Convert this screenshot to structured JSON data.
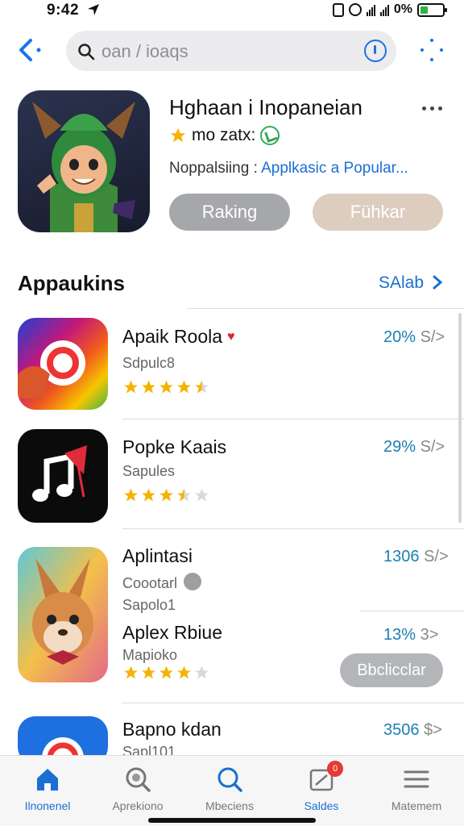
{
  "status_bar": {
    "time": "9:42",
    "battery": "0%"
  },
  "search": {
    "placeholder": "oan / ioaqs"
  },
  "featured": {
    "title": "Hghaan i Inopaneian",
    "meta": "mo zatx:",
    "subtitle_prefix": "Noppalsiing :",
    "subtitle_link": "Applkasic a Popular...",
    "buttons": {
      "primary": "Raking",
      "secondary": "Fühkar"
    }
  },
  "section": {
    "title": "Appaukins",
    "see_all": "SAlab"
  },
  "apps": [
    {
      "name": "Apaik Roola",
      "sub": "Sdpulc8",
      "pct": "20%",
      "pct_tail": "S/>",
      "rating": 4.5
    },
    {
      "name": "Popke Kaais",
      "sub": "Sapules",
      "pct": "29%",
      "pct_tail": "S/>",
      "rating": 3.5
    },
    {
      "name": "Aplintasi",
      "sub": "Coootarl",
      "sub2": "Sapolo1",
      "pct": "1306",
      "pct_tail": "S/>"
    },
    {
      "name": "Aplex Rbiue",
      "sub": "Mapioko",
      "pct": "13%",
      "pct_tail": "3>",
      "rating": 4.0,
      "button": "Bbclicclar"
    },
    {
      "name": "Bapno kdan",
      "sub": "Sapl101",
      "pct": "3506",
      "pct_tail": "$>"
    }
  ],
  "tabs": [
    {
      "label": "Ilnonenel",
      "icon": "home-icon",
      "active": true
    },
    {
      "label": "Aprekiono",
      "icon": "magnifier-badge-icon"
    },
    {
      "label": "Mbeciens",
      "icon": "search-icon"
    },
    {
      "label": "Saldes",
      "icon": "updates-icon",
      "badge": "0"
    },
    {
      "label": "Matemem",
      "icon": "menu-icon"
    }
  ],
  "colors": {
    "accent": "#1a6fd1",
    "star": "#f5b300",
    "badge": "#e53935"
  }
}
